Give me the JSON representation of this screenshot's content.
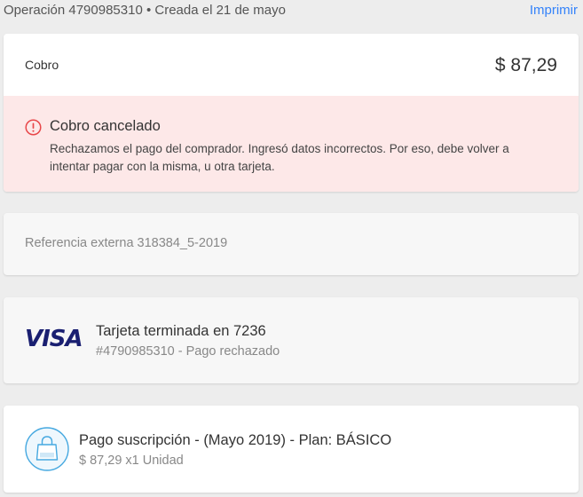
{
  "header": {
    "operation_text": "Operación 4790985310 • Creada el 21 de mayo",
    "print_label": "Imprimir"
  },
  "charge": {
    "label": "Cobro",
    "amount": "$ 87,29"
  },
  "alert": {
    "icon": "alert-circle-icon",
    "title": "Cobro cancelado",
    "description": "Rechazamos el pago del comprador. Ingresó datos incorrectos. Por eso, debe volver a intentar pagar con la misma, u otra tarjeta.",
    "color": "#e8474a",
    "background": "#fde8e8"
  },
  "reference": {
    "text": "Referencia externa 318384_5-2019"
  },
  "payment_card": {
    "brand": "VISA",
    "title": "Tarjeta terminada en 7236",
    "subtitle": "#4790985310 - Pago rechazado"
  },
  "item": {
    "icon": "shopping-bag-icon",
    "title": "Pago suscripción - (Mayo 2019) - Plan: BÁSICO",
    "subtitle": "$ 87,29 x1 Unidad"
  },
  "colors": {
    "link": "#3483fa",
    "visa": "#1a1f71",
    "bag_icon": "#45a8e0"
  }
}
